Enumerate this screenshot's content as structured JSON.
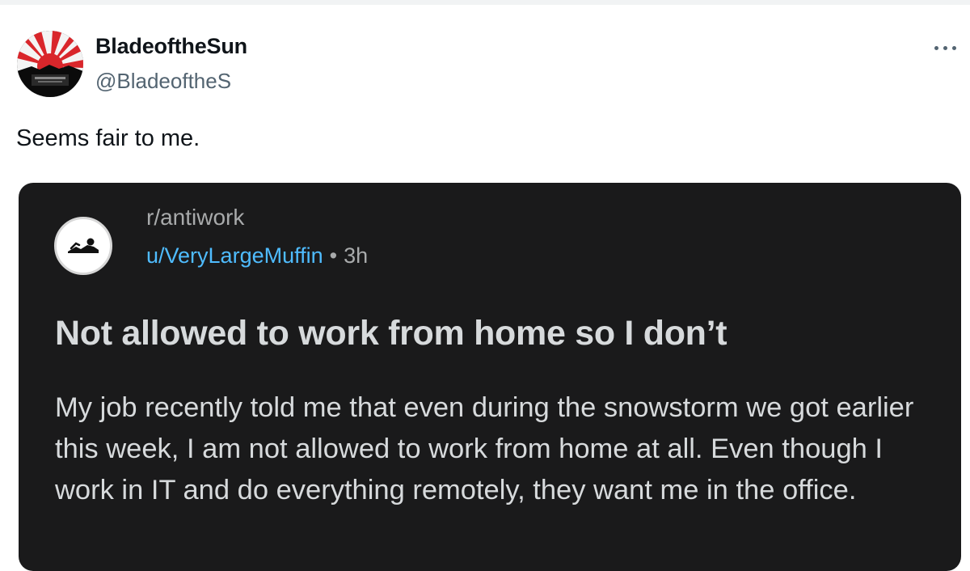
{
  "tweet": {
    "display_name": "BladeoftheSun",
    "handle": "@BladeoftheS",
    "text": "Seems fair to me.",
    "more_icon": "ellipsis-icon",
    "avatar_icon": "rising-sun-avatar"
  },
  "reddit_post": {
    "subreddit": "r/antiwork",
    "username": "u/VeryLargeMuffin",
    "separator": "•",
    "age": "3h",
    "title": "Not allowed to work from home so I don’t",
    "body": "My job recently told me that even during the snowstorm we got earlier this week, I am not allowed to work from home at all. Even though I work in IT and do everything remotely, they want me in the office.",
    "subreddit_icon": "reclining-figure-icon"
  },
  "colors": {
    "tweet_text": "#0f1419",
    "tweet_secondary": "#536471",
    "card_background": "#1a1a1b",
    "card_text": "#d7dadc",
    "card_meta": "#a8aaab",
    "username_link": "#4fbcff",
    "avatar_red": "#d9262b"
  }
}
